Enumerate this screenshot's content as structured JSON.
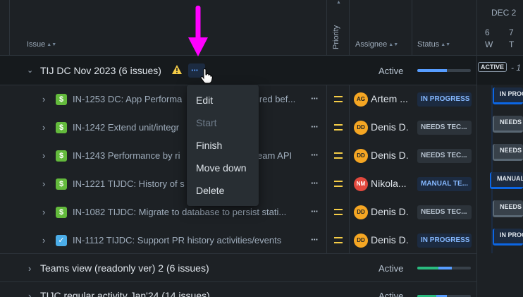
{
  "header": {
    "issue_label": "Issue",
    "priority_label": "Priority",
    "assignee_label": "Assignee",
    "status_label": "Status",
    "timeline_month": "DEC 2",
    "timeline_days": [
      {
        "num": "6",
        "dow": "W"
      },
      {
        "num": "7",
        "dow": "T"
      }
    ]
  },
  "groups": [
    {
      "title": "TIJ DC Nov 2023 (6 issues)",
      "status": "Active",
      "progress_done": 0.55,
      "progress_color": "#579dff"
    },
    {
      "title": "Teams view (readonly ver) 2 (6 issues)",
      "status": "Active",
      "progress_done": 0.4,
      "progress_inprogress": 0.25
    },
    {
      "title": "TIJC regular activity Jan'24 (14 issues)",
      "status": "Active",
      "progress_done": 0.35,
      "progress_inprogress": 0.2
    }
  ],
  "issues": [
    {
      "key_text": "IN-1253 DC: App Performa",
      "text_tail": "ired bef...",
      "type": "story",
      "avatar": "AG",
      "avatar_color": "#f5a623",
      "assignee": "Artem ...",
      "status": "IN PROGRESS"
    },
    {
      "key_text": "IN-1242 Extend unit/integr",
      "text_tail": "",
      "type": "story",
      "avatar": "DD",
      "avatar_color": "#f5a623",
      "assignee": "Denis D.",
      "status": "NEEDS TEC..."
    },
    {
      "key_text": "IN-1243 Performance by ri",
      "text_tail": "eam API",
      "type": "story",
      "avatar": "DD",
      "avatar_color": "#f5a623",
      "assignee": "Denis D.",
      "status": "NEEDS TEC..."
    },
    {
      "key_text": "IN-1221 TIJDC: History of s",
      "text_tail": "",
      "type": "story",
      "avatar": "NM",
      "avatar_color": "#e2483d",
      "assignee": "Nikola...",
      "status": "MANUAL TE..."
    },
    {
      "key_text": "IN-1082 TIJDC: Migrate to database to persist stati...",
      "text_tail": "",
      "type": "story",
      "avatar": "DD",
      "avatar_color": "#f5a623",
      "assignee": "Denis D.",
      "status": "NEEDS TEC..."
    },
    {
      "key_text": "IN-1112 TIJDC: Support PR history activities/events",
      "text_tail": "",
      "type": "task",
      "avatar": "DD",
      "avatar_color": "#f5a623",
      "assignee": "Denis D.",
      "status": "IN PROGRESS"
    }
  ],
  "timeline": {
    "active_badge": "ACTIVE",
    "active_suffix": "- 1",
    "bars": [
      {
        "label": "IN PROG",
        "style": "progress"
      },
      {
        "label": "NEEDS T",
        "style": "needs"
      },
      {
        "label": "NEEDS T",
        "style": "needs"
      },
      {
        "label": "MANUAL",
        "style": "manual"
      },
      {
        "label": "NEEDS T",
        "style": "needs"
      },
      {
        "label": "IN PROG",
        "style": "progress"
      }
    ]
  },
  "context_menu": {
    "items": [
      {
        "label": "Edit",
        "enabled": true
      },
      {
        "label": "Start",
        "enabled": false
      },
      {
        "label": "Finish",
        "enabled": true
      },
      {
        "label": "Move down",
        "enabled": true
      },
      {
        "label": "Delete",
        "enabled": true
      }
    ]
  },
  "annotation": {
    "arrow_color": "#ff00ff"
  },
  "colors": {
    "background": "#1d2125",
    "epic_row": "#161a1d",
    "accent": "#579dff",
    "priority_medium": "#f5cd47",
    "done_green": "#2abb7f"
  }
}
